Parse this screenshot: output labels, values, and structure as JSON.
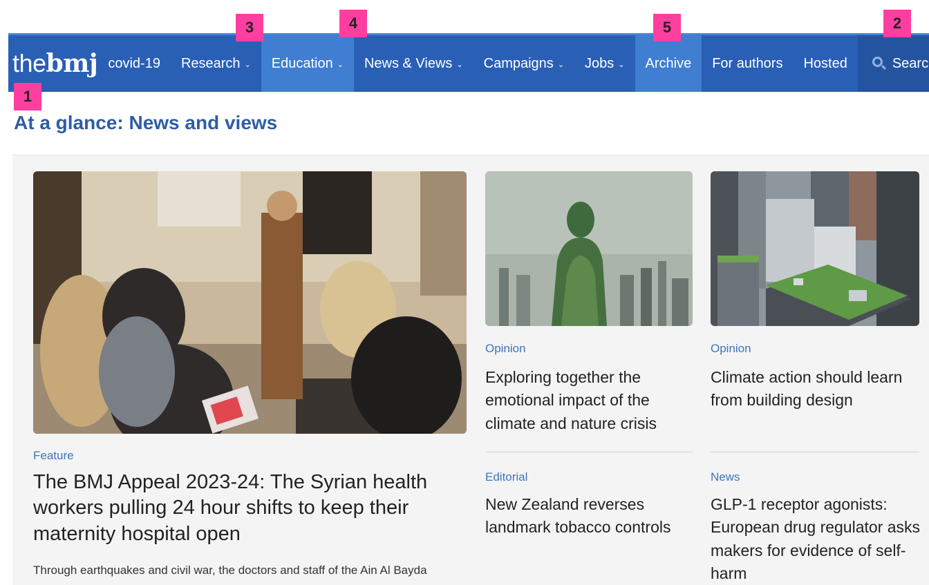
{
  "brand": {
    "logo_thin": "the",
    "logo_bold": "bmj"
  },
  "nav": {
    "covid": "covid-19",
    "research": "Research",
    "education": "Education",
    "news_views": "News & Views",
    "campaigns": "Campaigns",
    "jobs": "Jobs",
    "archive": "Archive",
    "for_authors": "For authors",
    "hosted": "Hosted",
    "search": "Search",
    "dropdown_glyph": "⌄"
  },
  "markers": {
    "m1": "1",
    "m2": "2",
    "m3": "3",
    "m4": "4",
    "m5": "5"
  },
  "section": {
    "prefix": "At a glance: ",
    "title": "News and views"
  },
  "feature": {
    "kicker": "Feature",
    "headline": "The BMJ Appeal 2023-24: The Syrian health workers pulling 24 hour shifts to keep their maternity hospital open",
    "standfirst": "Through earthquakes and civil war, the doctors and staff of the Ain Al Bayda"
  },
  "cards": [
    {
      "kicker": "Opinion",
      "headline": "Exploring together the emotional impact of the climate and nature crisis"
    },
    {
      "kicker": "Opinion",
      "headline": "Climate action should learn from building design"
    },
    {
      "kicker": "Editorial",
      "headline": "New Zealand reverses landmark tobacco controls"
    },
    {
      "kicker": "News",
      "headline": "GLP-1 receptor agonists: European drug regulator asks makers for evidence of self-harm"
    }
  ],
  "colors": {
    "nav_bg": "#2a5fb6",
    "nav_highlight": "#3f7ed1",
    "accent_blue": "#2d5da6",
    "marker": "#ff3fa0"
  }
}
